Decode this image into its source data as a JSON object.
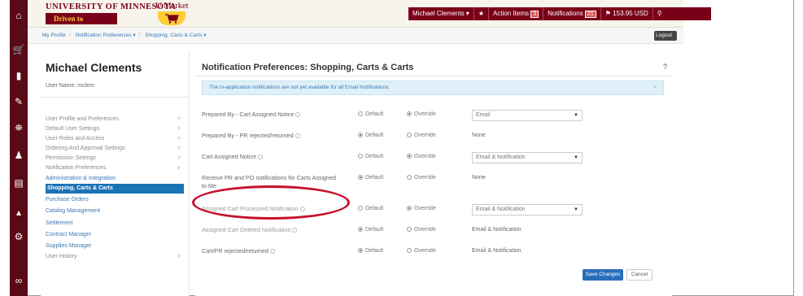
{
  "header": {
    "university": "UNIVERSITY OF MINNESOTA",
    "tagline": "Driven to Discover™",
    "app_name": "U Market",
    "user_menu": "Michael Clements ▾",
    "action_items_label": "Action Items",
    "action_items_count": "3",
    "notifications_label": "Notifications",
    "notifications_count": "21",
    "cart_total": "153.95 USD",
    "star_icon": "★",
    "cart_icon": "⚑",
    "search_icon": "⚲"
  },
  "breadcrumb": {
    "items": [
      "My Profile",
      "Notification Preferences ▾",
      "Shopping, Carts & Carts ▾"
    ],
    "logout_label": "Logout"
  },
  "left_panel": {
    "name": "Michael Clements",
    "user_name": "User Name: mclem",
    "items": [
      "User Profile and Preferences",
      "Default User Settings",
      "User Roles and Access",
      "Ordering And Approval Settings",
      "Permission Settings",
      "Notification Preferences"
    ],
    "subitems": [
      "Administration & Integration",
      "Shopping, Carts & Carts",
      "Purchase Orders",
      "Catalog Management",
      "Settlement",
      "Contract Manager",
      "Supplies Manager"
    ],
    "last_item": "User History"
  },
  "main": {
    "title": "Notification Preferences:  Shopping, Carts & Carts",
    "help": "?",
    "notice": "The in-application notifications are not yet available for all Email Notifications.",
    "default_label": "Default",
    "override_label": "Override",
    "rows": [
      {
        "label": "Prepared By - Cart Assigned Notice",
        "value": "Email"
      },
      {
        "label": "Prepared By - PR rejected/returned",
        "value": "None"
      },
      {
        "label": "Cart Assigned Notice",
        "value": "Email & Notification"
      },
      {
        "label": "Receive PR and PO notifications for Carts Assigned to Me",
        "value": "None"
      },
      {
        "label": "Assigned Cart Processed Notification",
        "value": "Email & Notification"
      },
      {
        "label": "Assigned Cart Deleted Notification",
        "value": "Email & Notification"
      },
      {
        "label": "Cart/PR rejected/returned",
        "value": "Email & Notification"
      }
    ],
    "save_label": "Save Changes",
    "cancel_label": "Cancel"
  },
  "colors": {
    "maroon": "#7a0019",
    "gold": "#ffcc33",
    "accent_blue": "#1a73b5",
    "highlight_red": "#c8102e"
  }
}
